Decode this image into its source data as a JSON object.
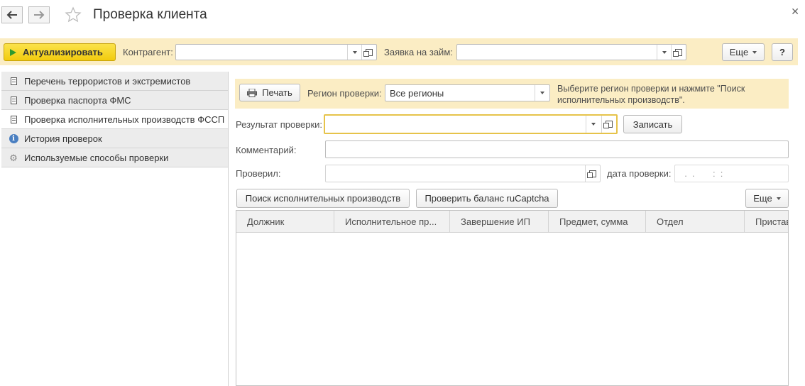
{
  "window": {
    "title": "Проверка клиента"
  },
  "toolbar": {
    "refresh_label": "Актуализировать",
    "counterparty_label": "Контрагент:",
    "counterparty_value": "",
    "loan_label": "Заявка на займ:",
    "loan_value": "",
    "more_label": "Еще",
    "help_label": "?"
  },
  "sidebar": {
    "items": [
      {
        "label": "Перечень террористов и экстремистов",
        "icon": "document-icon"
      },
      {
        "label": "Проверка паспорта ФМС",
        "icon": "document-icon"
      },
      {
        "label": "Проверка исполнительных производств ФССП",
        "icon": "document-icon",
        "active": true
      },
      {
        "label": "История проверок",
        "icon": "info-icon"
      },
      {
        "label": "Используемые способы проверки",
        "icon": "gear-icon"
      }
    ]
  },
  "main": {
    "print_label": "Печать",
    "region_label": "Регион проверки:",
    "region_value": "Все регионы",
    "hint": "Выберите регион проверки и нажмите \"Поиск исполнительных производств\".",
    "result_label": "Результат проверки:",
    "result_value": "",
    "save_label": "Записать",
    "comment_label": "Комментарий:",
    "comment_value": "",
    "checked_by_label": "Проверил:",
    "checked_by_value": "",
    "check_date_label": "дата проверки:",
    "check_date_value": "  .  .       :  :",
    "search_label": "Поиск исполнительных производств",
    "balance_label": "Проверить баланс ruCaptcha",
    "more_label": "Еще",
    "table": {
      "columns": [
        "Должник",
        "Исполнительное пр...",
        "Завершение ИП",
        "Предмет, сумма",
        "Отдел",
        "Пристав"
      ],
      "rows": []
    }
  },
  "colors": {
    "primary_button": "#f5d31c",
    "command_bar": "#fbedc4",
    "focus_border": "#e6c34a"
  }
}
